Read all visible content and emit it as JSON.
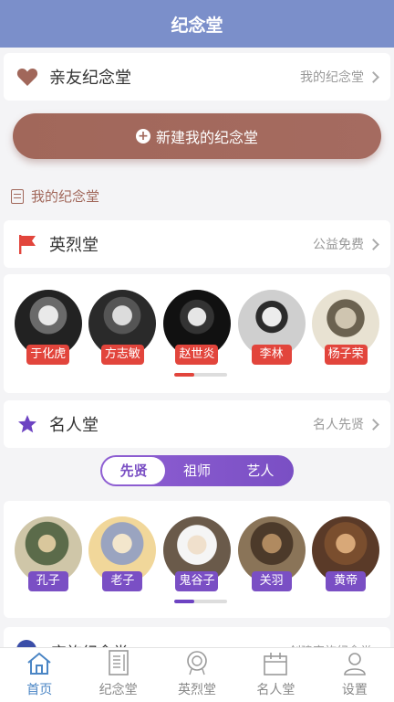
{
  "header": {
    "title": "纪念堂"
  },
  "family": {
    "title": "亲友纪念堂",
    "link": "我的纪念堂"
  },
  "new_button": {
    "label": "新建我的纪念堂"
  },
  "mine": {
    "label": "我的纪念堂"
  },
  "martyrs": {
    "title": "英烈堂",
    "link": "公益免费",
    "people": [
      "于化虎",
      "方志敏",
      "赵世炎",
      "李林",
      "杨子荣"
    ],
    "scroll_progress": 0.38
  },
  "celebrities": {
    "title": "名人堂",
    "link": "名人先贤",
    "tabs": [
      "先贤",
      "祖师",
      "艺人"
    ],
    "active_tab": 0,
    "people": [
      "孔子",
      "老子",
      "鬼谷子",
      "关羽",
      "黄帝"
    ],
    "scroll_progress": 0.38
  },
  "peek_section": {
    "title": "宗族纪念堂",
    "link": "创建宗族纪念堂"
  },
  "tabbar": {
    "items": [
      "首页",
      "纪念堂",
      "英烈堂",
      "名人堂",
      "设置"
    ],
    "active": 0
  },
  "colors": {
    "header": "#7b8fca",
    "accent_brown": "#a1675a",
    "martyr_red": "#e2453c",
    "celebrity_purple": "#7a4fc4",
    "tab_active": "#4b86c5"
  }
}
